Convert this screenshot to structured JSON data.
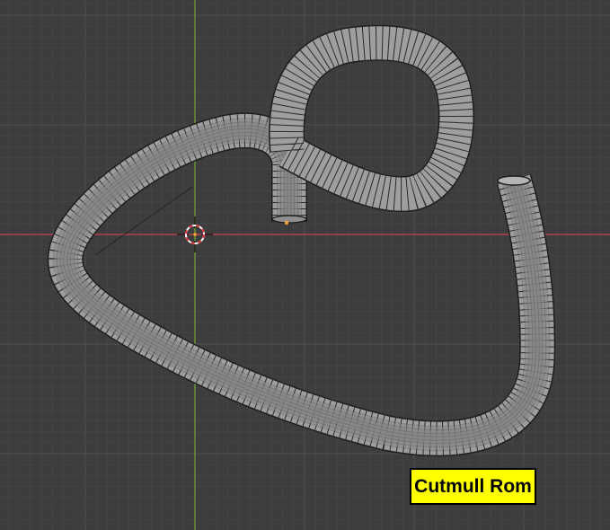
{
  "viewport": {
    "label": "Cutmull Rom",
    "colors": {
      "background": "#3d3d3d",
      "grid_minor": "#444444",
      "grid_major": "#4d4d4d",
      "axis_x": "#b0414f",
      "axis_y": "#6a9634",
      "tube_fill": "#9e9e9e",
      "tube_wire": "#1e1e1e",
      "label_bg": "#ffff00",
      "label_text": "#000000",
      "cursor_ring": "#ffffff",
      "cursor_ring_alt": "#e0303a",
      "origin_dot": "#f2a03a"
    },
    "icons": [
      "3d-cursor-icon",
      "object-origin-icon"
    ]
  }
}
